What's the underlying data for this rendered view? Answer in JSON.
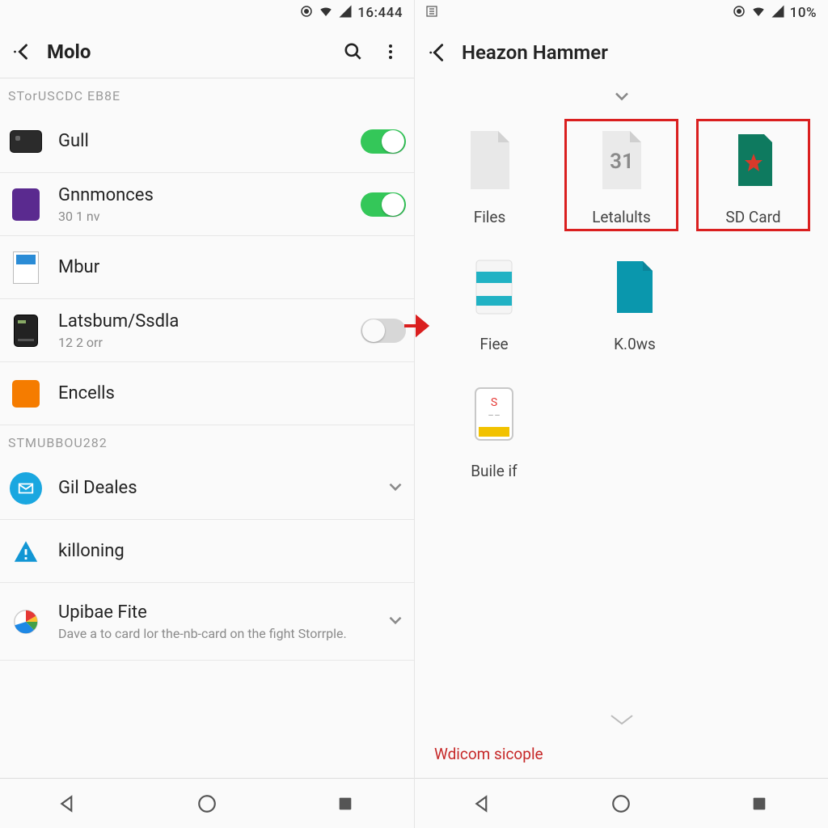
{
  "left": {
    "status": {
      "time": "16:444"
    },
    "appbar": {
      "title": "Molo"
    },
    "section1": {
      "header": "STorUSCDC EB8E",
      "items": [
        {
          "label": "Gull",
          "sub": "",
          "toggle": "on",
          "icon": "dark"
        },
        {
          "label": "Gnnmonces",
          "sub": "30 1 nv",
          "toggle": "on",
          "icon": "purple"
        },
        {
          "label": "Mbur",
          "sub": "",
          "toggle": "",
          "icon": "bluefile"
        },
        {
          "label": "Latsbum/Ssdla",
          "sub": "12 2 orr",
          "toggle": "off",
          "icon": "card"
        },
        {
          "label": "Encells",
          "sub": "",
          "toggle": "",
          "icon": "orange"
        }
      ]
    },
    "section2": {
      "header": "STMUBBOU282",
      "items": [
        {
          "label": "Gil Deales",
          "icon": "mail",
          "chev": true
        },
        {
          "label": "killoning",
          "icon": "alert"
        },
        {
          "label": "Upibae Fite",
          "sub": "Dave a to card lor the-nb-card on the fight Storrple.",
          "icon": "pie",
          "chev": true
        }
      ]
    }
  },
  "right": {
    "status": {
      "battery": "10%"
    },
    "appbar": {
      "title": "Heazon Hammer"
    },
    "tiles": {
      "row1": [
        {
          "label": "Files",
          "icon": "file-blank",
          "hl": false
        },
        {
          "label": "Letalults",
          "icon": "file-31",
          "hl": true
        },
        {
          "label": "SD Card",
          "icon": "sdcard",
          "hl": true
        }
      ],
      "row2": [
        {
          "label": "Fiee",
          "icon": "file-bars"
        },
        {
          "label": "K.0ws",
          "icon": "file-teal"
        }
      ],
      "row3": [
        {
          "label": "Buile if",
          "icon": "sim"
        }
      ]
    },
    "bottom_hint": "Wdicom sicople"
  }
}
